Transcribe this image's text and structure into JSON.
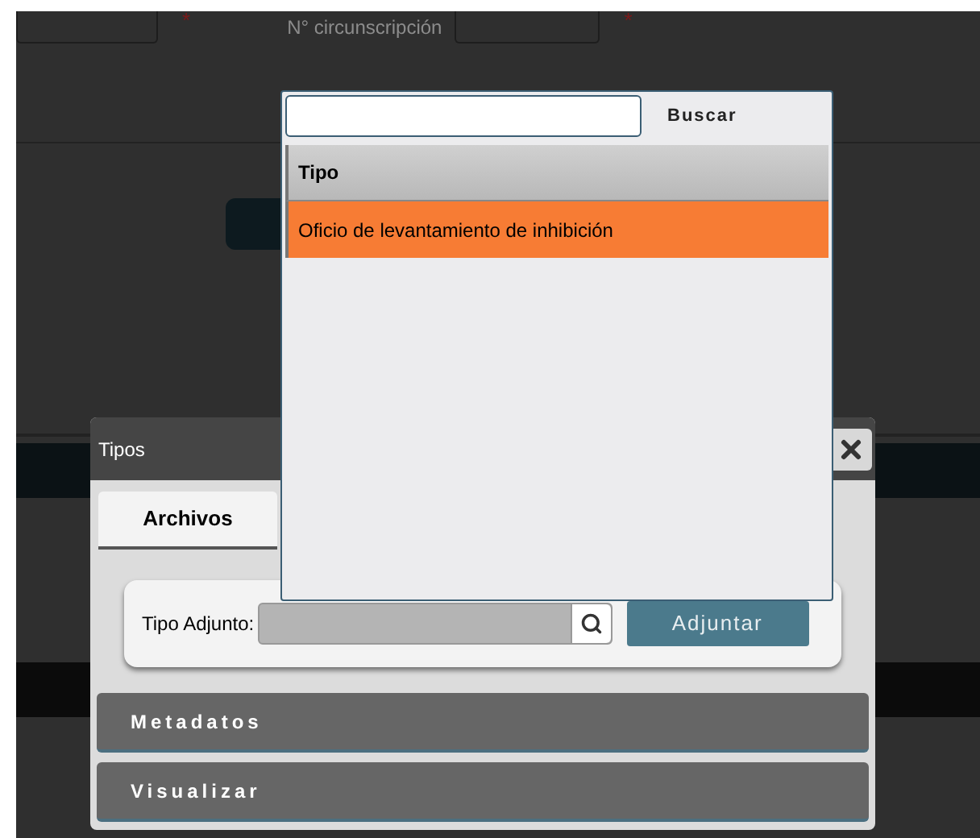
{
  "background_form": {
    "field_label": "N° circunscripción",
    "required_mark": "*"
  },
  "dialog": {
    "title": "Tipos",
    "tabs": [
      {
        "label": "Archivos",
        "selected": true
      }
    ],
    "attach": {
      "label": "Tipo Adjunto:",
      "button": "Adjuntar"
    },
    "sections": [
      {
        "label": "Metadatos"
      },
      {
        "label": "Visualizar"
      }
    ]
  },
  "picker": {
    "search_button": "Buscar",
    "column": "Tipo",
    "rows": [
      {
        "label": "Oficio de levantamiento de inhibición",
        "selected": true
      }
    ]
  }
}
